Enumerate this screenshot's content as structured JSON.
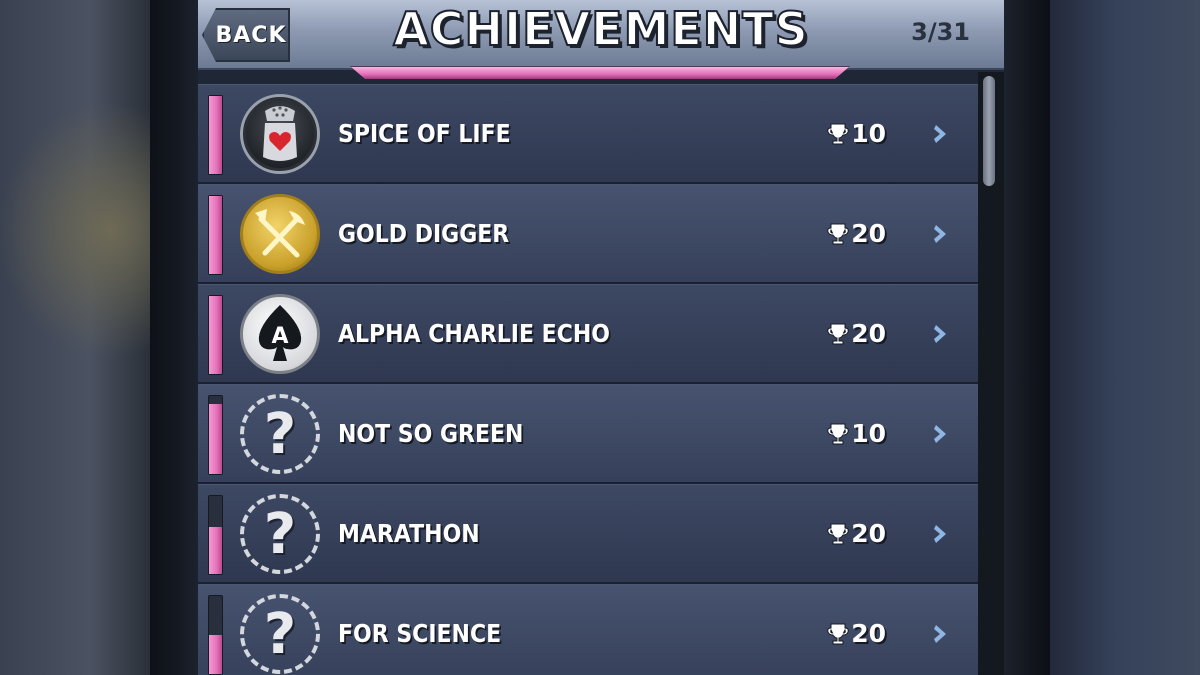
{
  "header": {
    "back_label": "BACK",
    "title": "ACHIEVEMENTS",
    "counter": "3/31"
  },
  "achievements": [
    {
      "name": "SPICE OF LIFE",
      "points": "10",
      "unlocked": true,
      "icon": "salt-shaker-heart-icon",
      "progress": 1.0
    },
    {
      "name": "GOLD DIGGER",
      "points": "20",
      "unlocked": true,
      "icon": "pickaxe-shovel-icon",
      "progress": 1.0
    },
    {
      "name": "ALPHA CHARLIE ECHO",
      "points": "20",
      "unlocked": true,
      "icon": "ace-spade-icon",
      "progress": 1.0
    },
    {
      "name": "NOT SO GREEN",
      "points": "10",
      "unlocked": false,
      "icon": "question-mark-icon",
      "progress": 0.9
    },
    {
      "name": "MARATHON",
      "points": "20",
      "unlocked": false,
      "icon": "question-mark-icon",
      "progress": 0.6
    },
    {
      "name": "FOR SCIENCE",
      "points": "20",
      "unlocked": false,
      "icon": "question-mark-icon",
      "progress": 0.5
    }
  ],
  "colors": {
    "accent_pink": "#e570b8",
    "row_dark": "#2f3850",
    "row_light": "#36405a",
    "header": "#8d9ab2"
  }
}
